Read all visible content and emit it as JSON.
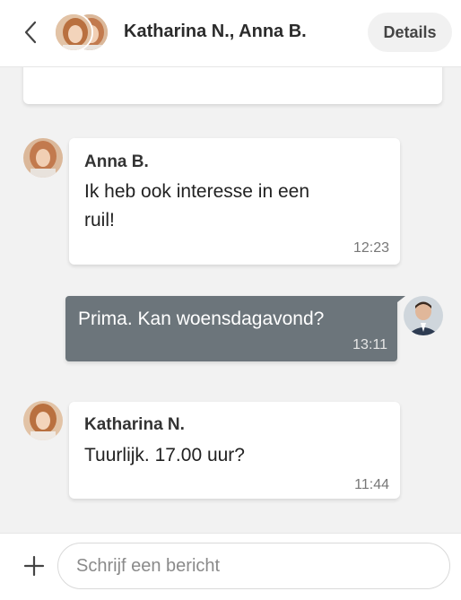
{
  "header": {
    "title": "Katharina N., Anna B.",
    "details_label": "Details"
  },
  "messages": [
    {
      "sender": "Anna B.",
      "text_line1": "Ik heb ook interesse in een",
      "text_line2": "ruil!",
      "time": "12:23"
    },
    {
      "text": "Prima. Kan woensdagavond?",
      "time": "13:11"
    },
    {
      "sender": "Katharina N.",
      "text": "Tuurlijk. 17.00 uur?",
      "time": "11:44"
    }
  ],
  "composer": {
    "placeholder": "Schrijf een bericht"
  },
  "colors": {
    "outgoing_bubble": "#6c757b",
    "background": "#f2f2f2"
  }
}
